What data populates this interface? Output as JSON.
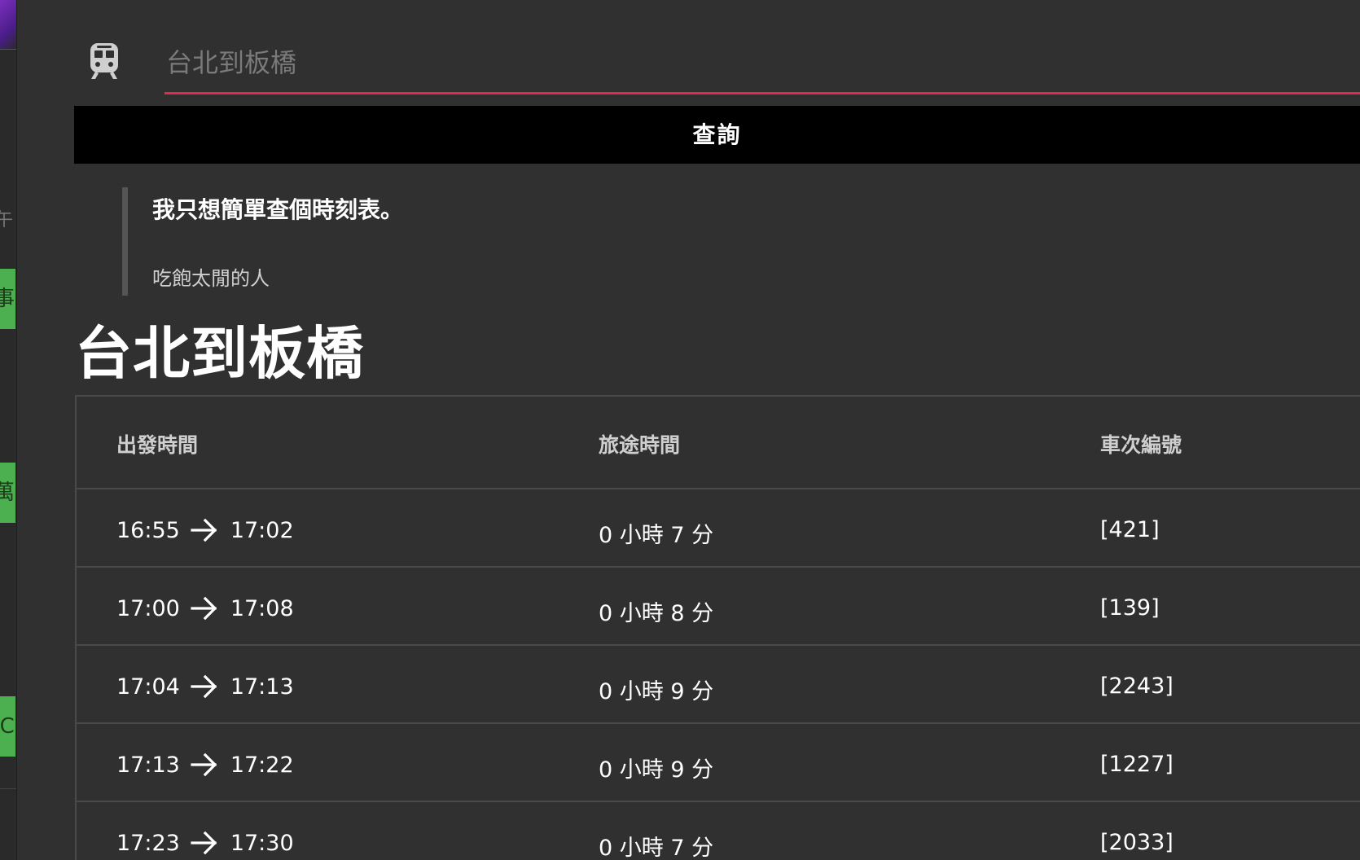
{
  "side_strip": {
    "glyphs": [
      "午",
      "事",
      "萬",
      "IC"
    ]
  },
  "search": {
    "placeholder": "台北到板橋",
    "value": ""
  },
  "query_button": {
    "label": "查詢"
  },
  "quote": {
    "text": "我只想簡單查個時刻表。",
    "author": "吃飽太閒的人"
  },
  "route_title": "台北到板橋",
  "table": {
    "headers": [
      "出發時間",
      "旅途時間",
      "車次編號"
    ],
    "rows": [
      {
        "depart": "16:55",
        "arrive": "17:02",
        "duration": "0 小時 7 分",
        "train": "[421]"
      },
      {
        "depart": "17:00",
        "arrive": "17:08",
        "duration": "0 小時 8 分",
        "train": "[139]"
      },
      {
        "depart": "17:04",
        "arrive": "17:13",
        "duration": "0 小時 9 分",
        "train": "[2243]"
      },
      {
        "depart": "17:13",
        "arrive": "17:22",
        "duration": "0 小時 9 分",
        "train": "[1227]"
      },
      {
        "depart": "17:23",
        "arrive": "17:30",
        "duration": "0 小時 7 分",
        "train": "[2033]"
      }
    ]
  },
  "colors": {
    "background": "#303030",
    "accent_underline": "#e8274b",
    "button_bg": "#000000",
    "strip_green": "#4caf50"
  }
}
